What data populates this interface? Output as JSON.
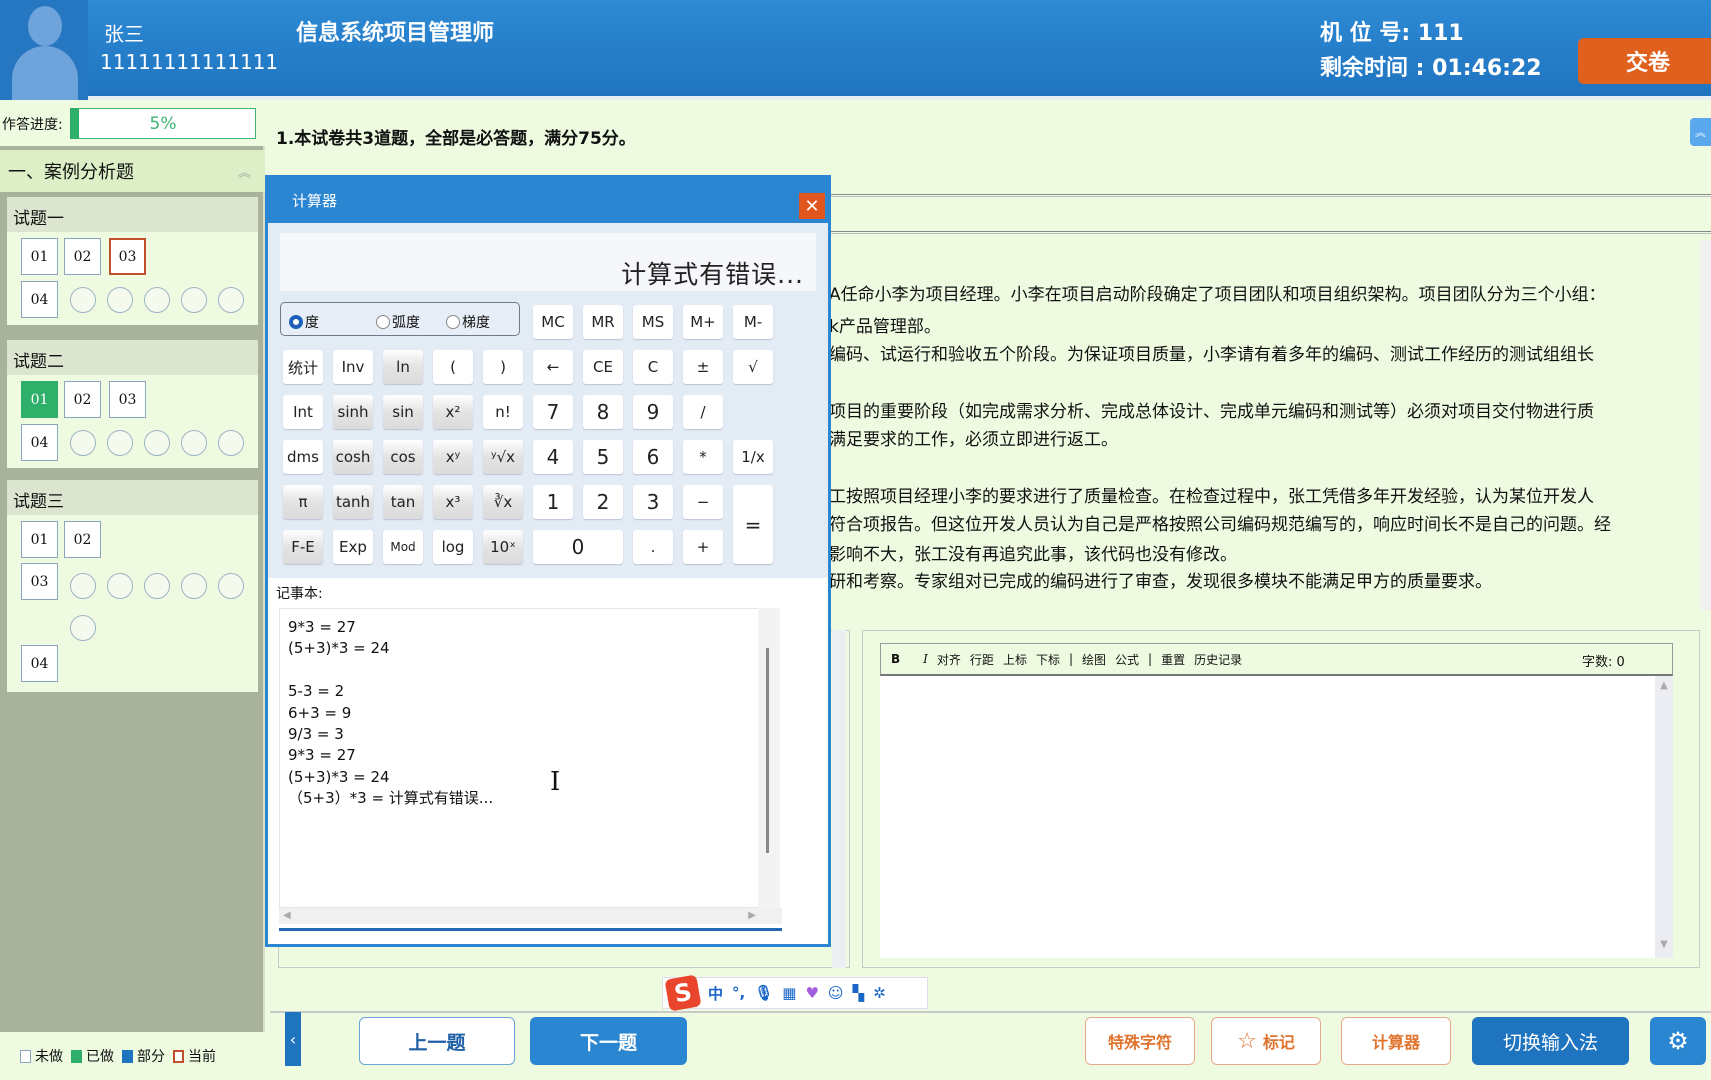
{
  "header": {
    "user_name": "张三",
    "user_id": "11111111111111",
    "exam_title": "信息系统项目管理师",
    "seat_label": "机 位 号: 111",
    "time_label": "剩余时间 : 01:46:22",
    "submit_label": "交卷",
    "accent": "#2a86d0",
    "submit_color": "#e0601e"
  },
  "sidebar": {
    "progress_label": "作答进度:",
    "progress_value": "5%",
    "progress_percent": 5,
    "section_title": "一、案例分析题",
    "groups": [
      {
        "title": "试题一",
        "items": [
          {
            "label": "01",
            "state": "unanswered"
          },
          {
            "label": "02",
            "state": "unanswered"
          },
          {
            "label": "03",
            "state": "current"
          },
          {
            "label": "04",
            "state": "unanswered"
          }
        ]
      },
      {
        "title": "试题二",
        "items": [
          {
            "label": "01",
            "state": "done"
          },
          {
            "label": "02",
            "state": "unanswered"
          },
          {
            "label": "03",
            "state": "unanswered"
          },
          {
            "label": "04",
            "state": "unanswered"
          }
        ]
      },
      {
        "title": "试题三",
        "items": [
          {
            "label": "01",
            "state": "unanswered"
          },
          {
            "label": "02",
            "state": "unanswered"
          },
          {
            "label": "03",
            "state": "unanswered"
          },
          {
            "label": "04",
            "state": "unanswered"
          }
        ]
      }
    ],
    "legend": [
      {
        "label": "未做",
        "color": "#ffffff"
      },
      {
        "label": "已做",
        "color": "#2eb06a"
      },
      {
        "label": "部分",
        "color": "#1f74c0"
      },
      {
        "label": "当前",
        "color": "#c0502c"
      }
    ]
  },
  "main": {
    "notice": "1.本试卷共3道题，全部是必答题，满分75分。",
    "question_lines": [
      "A任命小李为项目经理。小李在项目启动阶段确定了项目团队和项目组织架构。项目团队分为三个小组：",
      "k产品管理部。",
      "编码、试运行和验收五个阶段。为保证项目质量，小李请有着多年的编码、测试工作经历的测试组组长",
      "项目的重要阶段（如完成需求分析、完成总体设计、完成单元编码和测试等）必须对项目交付物进行质",
      "满足要求的工作，必须立即进行返工。",
      "工按照项目经理小李的要求进行了质量检查。在检查过程中，张工凭借多年开发经验，认为某位开发人",
      "符合项报告。但这位开发人员认为自己是严格按照公司编码规范编写的，响应时间长不是自己的问题。经",
      "影响不大，张工没有再追究此事，该代码也没有修改。",
      "研和考察。专家组对已完成的编码进行了审查，发现很多模块不能满足甲方的质量要求。"
    ],
    "editor_toolbar": [
      "B",
      "I",
      "对齐",
      "行距",
      "上标",
      "下标",
      "|",
      "绘图",
      "公式",
      "|",
      "重置",
      "历史记录"
    ],
    "word_count": "字数: 0"
  },
  "ime": {
    "lang": "中",
    "punct": "°,"
  },
  "footer": {
    "prev": "上一题",
    "next": "下一题",
    "special_chars": "特殊字符",
    "mark": "标记",
    "calculator": "计算器",
    "switch_ime": "切换输入法"
  },
  "calculator": {
    "title": "计算器",
    "display": "计算式有错误...",
    "angle_modes": [
      {
        "label": "度",
        "selected": true
      },
      {
        "label": "弧度",
        "selected": false
      },
      {
        "label": "梯度",
        "selected": false
      }
    ],
    "memory": [
      "MC",
      "MR",
      "MS",
      "M+",
      "M-"
    ],
    "rows": [
      [
        "统计",
        "Inv",
        "ln",
        "(",
        ")",
        "←",
        "CE",
        "C",
        "±",
        "√"
      ],
      [
        "Int",
        "sinh",
        "sin",
        "x²",
        "n!",
        "7",
        "8",
        "9",
        "/"
      ],
      [
        "dms",
        "cosh",
        "cos",
        "xʸ",
        "ʸ√x",
        "4",
        "5",
        "6",
        "*",
        "1/x"
      ],
      [
        "π",
        "tanh",
        "tan",
        "x³",
        "∛x",
        "1",
        "2",
        "3",
        "−",
        "="
      ],
      [
        "F-E",
        "Exp",
        "Mod",
        "log",
        "10ˣ",
        "0",
        ".",
        "+"
      ]
    ],
    "notepad_label": "记事本:",
    "notepad_lines": [
      "9*3 = 27",
      "(5+3)*3 = 24",
      "",
      "5-3 = 2",
      "6+3 = 9",
      "9/3 = 3",
      "9*3 = 27",
      "(5+3)*3 = 24",
      "（5+3）*3 = 计算式有错误..."
    ]
  }
}
